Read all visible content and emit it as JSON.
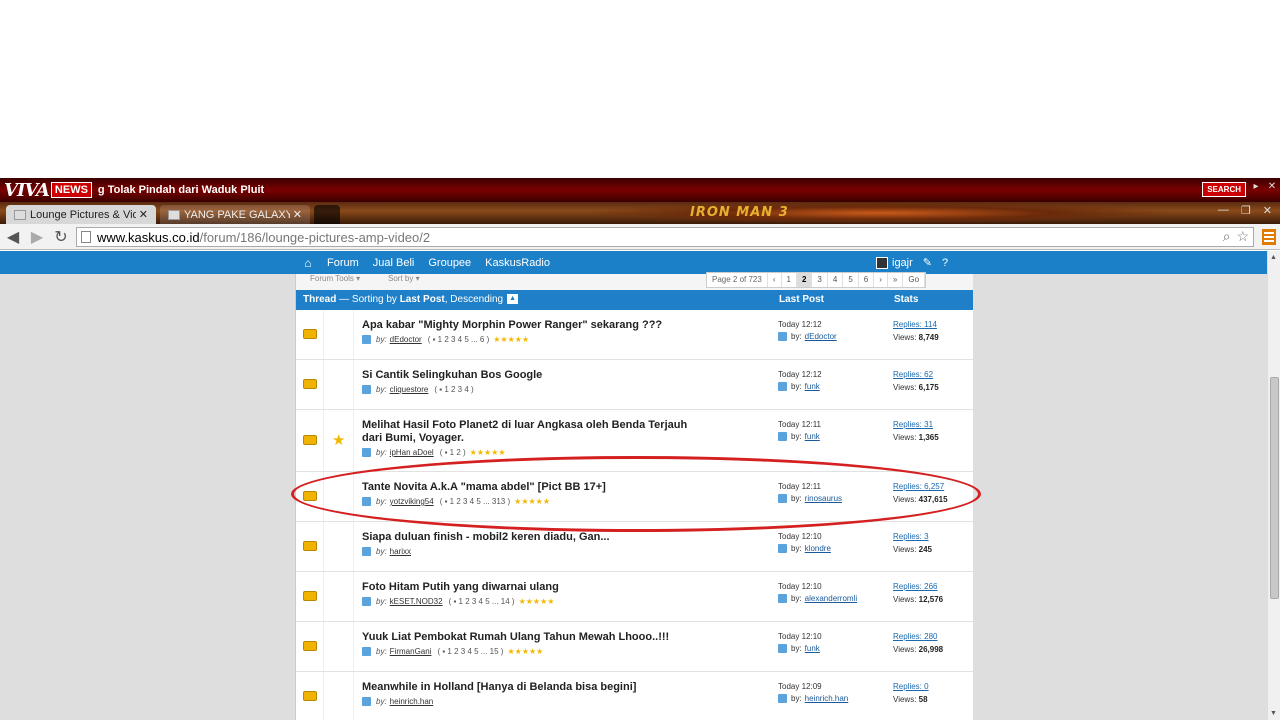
{
  "newsbar": {
    "logo_viva": "VIVA",
    "logo_news": "NEWS",
    "ticker": "g Tolak Pindah dari Waduk Pluit",
    "search_label": "SEARCH"
  },
  "tabs": [
    {
      "label": "Lounge Pictures & Video"
    },
    {
      "label": "YANG PAKE GALAXY NOT"
    }
  ],
  "banner_text": "IRON MAN 3",
  "address": {
    "host": "www.kaskus.co.id",
    "path": "/forum/186/lounge-pictures-amp-video/2"
  },
  "kaskus_nav": {
    "links": [
      "Forum",
      "Jual Beli",
      "Groupee",
      "KaskusRadio"
    ],
    "username": "igajr"
  },
  "toolbar": {
    "forum_tools": "Forum Tools",
    "sort_by": "Sort by",
    "page_info": "Page 2 of 723",
    "pages": [
      "1",
      "2",
      "3",
      "4",
      "5",
      "6"
    ],
    "current_page": "2",
    "go": "Go"
  },
  "thead": {
    "thread": "Thread",
    "sorting_prefix": " — Sorting by ",
    "sorting_key": "Last Post",
    "sorting_sep": ", ",
    "sorting_order": "Descending",
    "last_post": "Last Post",
    "stats": "Stats"
  },
  "threads": [
    {
      "title": "Apa kabar \"Mighty Morphin Power Ranger\" sekarang ???",
      "author": "dEdoctor",
      "pages": "1 2 3 4 5 ... 6",
      "rating": "★★★★★",
      "time": "Today 12:12",
      "last_user": "dEdoctor",
      "replies": "114",
      "views": "8,749"
    },
    {
      "title": "Si Cantik Selingkuhan Bos Google",
      "author": "cliquestore",
      "pages": "1 2 3 4",
      "rating": "",
      "time": "Today 12:12",
      "last_user": "funk",
      "replies": "62",
      "views": "6,175"
    },
    {
      "title": "Melihat Hasil Foto Planet2 di luar Angkasa oleh Benda Terjauh dari Bumi, Voyager.",
      "author": "ipHan aDoel",
      "pages": "1 2",
      "rating": "★★★★★",
      "time": "Today 12:11",
      "last_user": "funk",
      "replies": "31",
      "views": "1,365"
    },
    {
      "title": "Tante Novita A.k.A \"mama abdel\" [Pict BB 17+]",
      "author": "yotzviking54",
      "pages": "1 2 3 4 5 ... 313",
      "rating": "★★★★★",
      "time": "Today 12:11",
      "last_user": "rinosaurus",
      "replies": "6,257",
      "views": "437,615"
    },
    {
      "title": "Siapa duluan finish - mobil2 keren diadu, Gan...",
      "author": "harixx",
      "pages": "",
      "rating": "",
      "time": "Today 12:10",
      "last_user": "klondre",
      "replies": "3",
      "views": "245"
    },
    {
      "title": "Foto Hitam Putih yang diwarnai ulang",
      "author": "kESET.NOD32",
      "pages": "1 2 3 4 5 ... 14",
      "rating": "★★★★★",
      "time": "Today 12:10",
      "last_user": "alexanderromli",
      "replies": "266",
      "views": "12,576"
    },
    {
      "title": "Yuuk Liat Pembokat Rumah Ulang Tahun Mewah Lhooo..!!!",
      "author": "FirmanGani",
      "pages": "1 2 3 4 5 ... 15",
      "rating": "★★★★★",
      "time": "Today 12:10",
      "last_user": "funk",
      "replies": "280",
      "views": "26,998"
    },
    {
      "title": "Meanwhile in Holland [Hanya di Belanda bisa begini]",
      "author": "heinrich.han",
      "pages": "",
      "rating": "",
      "time": "Today 12:09",
      "last_user": "heinrich.han",
      "replies": "0",
      "views": "58"
    }
  ],
  "labels": {
    "by": "by:",
    "replies": "Replies:",
    "views": "Views:"
  }
}
